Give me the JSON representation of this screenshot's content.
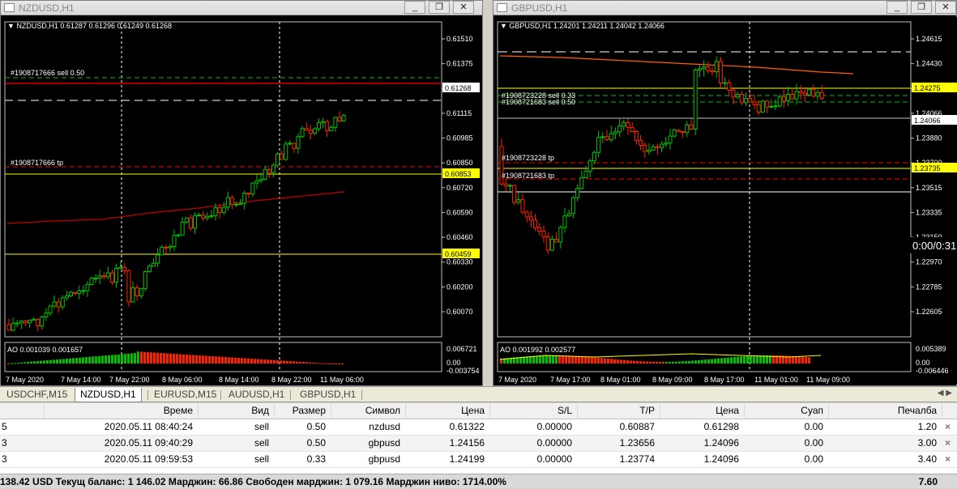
{
  "windows": [
    {
      "title": "NZDUSD,H1",
      "header": "NZDUSD,H1  0.61287 0.61296 0.61249 0.61268",
      "y_ticks": [
        "0.61510",
        "0.61375",
        "0.61245",
        "0.61115",
        "0.60985",
        "0.60850",
        "0.60720",
        "0.60590",
        "0.60460",
        "0.60330",
        "0.60200",
        "0.60070"
      ],
      "price_labels": [
        {
          "text": "0.61268",
          "bg": "#ffffff",
          "fg": "#000000"
        },
        {
          "text": "0.60853",
          "bg": "#ffff00",
          "fg": "#000000"
        },
        {
          "text": "0.60459",
          "bg": "#ffff00",
          "fg": "#000000"
        }
      ],
      "order_labels": [
        "#1908717666 sell 0.50",
        "#1908717666 tp"
      ],
      "indicator_header": "AO 0.001039 0.001657",
      "indicator_ticks": [
        "0.006721",
        "0.00",
        "-0.003754"
      ],
      "x_ticks": [
        "7 May 2020",
        "7 May 14:00",
        "7 May 22:00",
        "8 May 06:00",
        "8 May 14:00",
        "8 May 22:00",
        "11 May 06:00"
      ]
    },
    {
      "title": "GBPUSD,H1",
      "header": "GBPUSD,H1  1.24201 1.24211 1.24042 1.24066",
      "y_ticks": [
        "1.24615",
        "1.24430",
        "1.24250",
        "1.24066",
        "1.23880",
        "1.23700",
        "1.23515",
        "1.23335",
        "1.23150",
        "1.22970",
        "1.22785",
        "1.22605"
      ],
      "price_labels": [
        {
          "text": "1.24275",
          "bg": "#ffff00",
          "fg": "#000000"
        },
        {
          "text": "1.24066",
          "bg": "#ffffff",
          "fg": "#000000"
        },
        {
          "text": "1.23735",
          "bg": "#ffff00",
          "fg": "#000000"
        }
      ],
      "order_labels": [
        "#1908723228 sell 0.33",
        "#1908721683 sell 0.50",
        "#1908723228 tp",
        "#1908721683 tp"
      ],
      "indicator_header": "AO 0.001992 0.002577",
      "indicator_ticks": [
        "0.005389",
        "0.00",
        "-0.006446"
      ],
      "x_ticks": [
        "7 May 2020",
        "7 May 17:00",
        "8 May 01:00",
        "8 May 09:00",
        "8 May 17:00",
        "11 May 01:00",
        "11 May 09:00"
      ],
      "overlay_timer": "0:00/0:31"
    }
  ],
  "tabs": [
    "USDCHF,M15",
    "NZDUSD,H1",
    "EURUSD,M15",
    "AUDUSD,H1",
    "GBPUSD,H1"
  ],
  "active_tab": "NZDUSD,H1",
  "table": {
    "columns": [
      "",
      "Време",
      "Вид",
      "Размер",
      "Символ",
      "Цена",
      "S/L",
      "T/P",
      "Цена",
      "Суап",
      "Печалба"
    ],
    "rows": [
      [
        "5",
        "2020.05.11 08:40:24",
        "sell",
        "0.50",
        "nzdusd",
        "0.61322",
        "0.00000",
        "0.60887",
        "0.61298",
        "0.00",
        "1.20"
      ],
      [
        "3",
        "2020.05.11 09:40:29",
        "sell",
        "0.50",
        "gbpusd",
        "1.24156",
        "0.00000",
        "1.23656",
        "1.24096",
        "0.00",
        "3.00"
      ],
      [
        "3",
        "2020.05.11 09:59:53",
        "sell",
        "0.33",
        "gbpusd",
        "1.24199",
        "0.00000",
        "1.23774",
        "1.24096",
        "0.00",
        "3.40"
      ]
    ]
  },
  "status": {
    "summary": "138.42 USD  Текущ баланс: 1 146.02  Марджин: 66.86  Свободен марджин: 1 079.16  Марджин ниво: 1714.00%",
    "total": "7.60"
  },
  "colors": {
    "bull": "#00c000",
    "bear": "#ff2000",
    "ma": "#c00000",
    "yellow": "#ffff00"
  }
}
